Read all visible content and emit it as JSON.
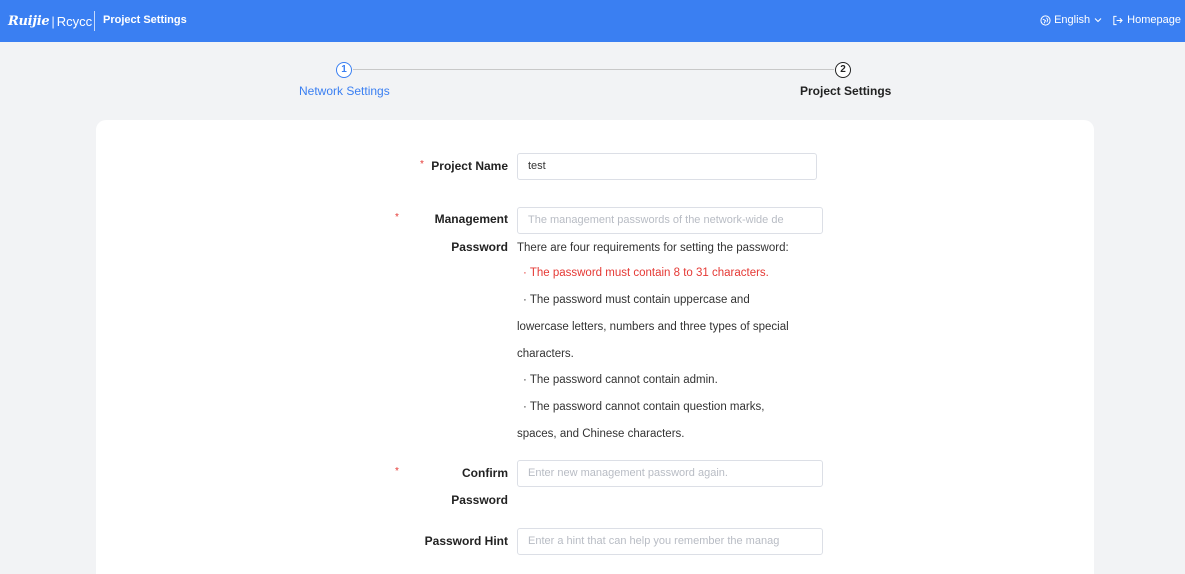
{
  "header": {
    "brand_ruijie": "Ruijie",
    "brand_separator": "|",
    "brand_rcycc": "Rcycc",
    "title": "Project Settings",
    "language_label": "English",
    "homepage_label": "Homepage",
    "bar_color": "#3a7ff2"
  },
  "steps": [
    {
      "number": "1",
      "label": "Network Settings",
      "state": "completed"
    },
    {
      "number": "2",
      "label": "Project Settings",
      "state": "current"
    }
  ],
  "form": {
    "required_mark": "*",
    "project_name": {
      "label": "Project Name",
      "value": "test"
    },
    "management_password": {
      "label_line1": "Management",
      "label_line2": "Password",
      "placeholder": "The management passwords of the network-wide de",
      "requirements_intro": "There are four requirements for setting the password:",
      "requirements": [
        {
          "text": "· The password must contain 8 to 31 characters.",
          "error": true
        },
        {
          "text": "· The password must contain uppercase and",
          "error": false
        },
        {
          "text": "lowercase letters, numbers and three types of special",
          "error": false
        },
        {
          "text": "characters.",
          "error": false
        },
        {
          "text": "· The password cannot contain admin.",
          "error": false
        },
        {
          "text": "· The password cannot contain question marks,",
          "error": false
        },
        {
          "text": "spaces, and Chinese characters.",
          "error": false
        }
      ]
    },
    "confirm_password": {
      "label_line1": "Confirm",
      "label_line2": "Password",
      "placeholder": "Enter new management password again."
    },
    "password_hint": {
      "label": "Password Hint",
      "placeholder": "Enter a hint that can help you remember the manag"
    }
  },
  "colors": {
    "accent": "#3a7ff2",
    "error": "#e53935"
  }
}
